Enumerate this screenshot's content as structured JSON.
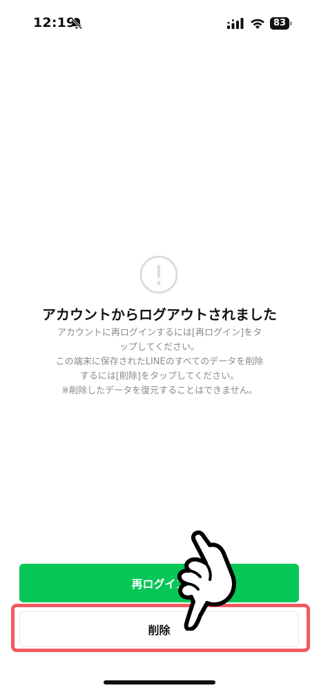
{
  "status_bar": {
    "time": "12:19",
    "battery": "83",
    "icons": [
      "bell-muted-icon",
      "signal-icon",
      "wifi-icon",
      "battery-icon"
    ]
  },
  "message": {
    "icon": "alert-circle-icon",
    "title": "アカウントからログアウトされました",
    "lines": [
      "アカウントに再ログインするには[再ログイン]をタ",
      "ップしてください。",
      "この端末に保存されたLINEのすべてのデータを削除",
      "するには[削除]をタップしてください。",
      "※削除したデータを復元することはできません。"
    ]
  },
  "buttons": {
    "relogin_label": "再ログイン",
    "delete_label": "削除"
  },
  "colors": {
    "primary_green": "#06c755",
    "highlight_red": "#f25a60",
    "text_gray": "#8a8a8a"
  },
  "annotation": {
    "icon": "pointing-hand-icon"
  }
}
